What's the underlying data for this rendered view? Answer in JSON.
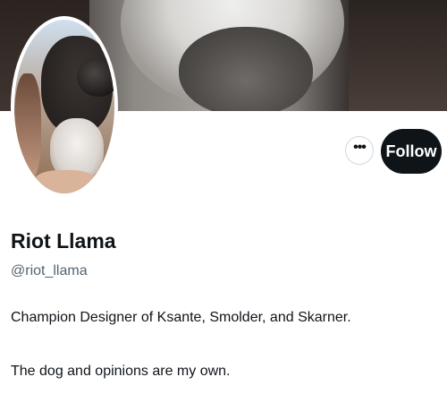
{
  "profile": {
    "display_name": "Riot Llama",
    "handle": "@riot_llama",
    "bio_lines": [
      "Champion Designer of Ksante, Smolder, and Skarner.",
      "The dog and opinions are my own."
    ]
  },
  "actions": {
    "more_label": "•••",
    "more_icon": "more-horizontal-icon",
    "follow_label": "Follow"
  },
  "colors": {
    "follow_bg": "#0f1419",
    "follow_text": "#ffffff",
    "handle_text": "#536471"
  }
}
